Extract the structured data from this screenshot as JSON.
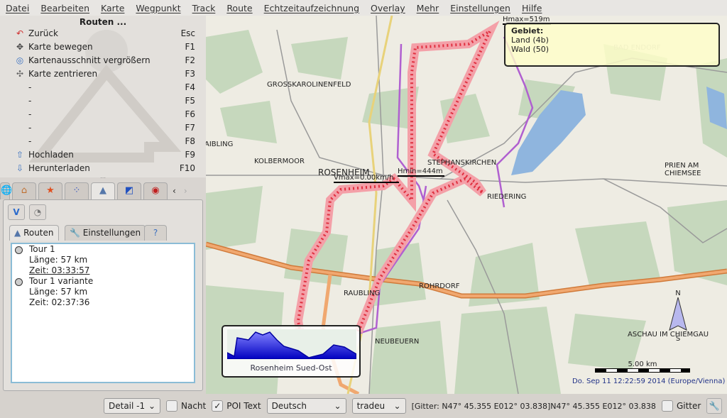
{
  "menu": [
    "Datei",
    "Bearbeiten",
    "Karte",
    "Wegpunkt",
    "Track",
    "Route",
    "Echtzeitaufzeichnung",
    "Overlay",
    "Mehr",
    "Einstellungen",
    "Hilfe"
  ],
  "shortcuts": {
    "title": "Routen ...",
    "items": [
      {
        "icon": "undo-arrow-icon",
        "label": "Zurück",
        "key": "Esc"
      },
      {
        "icon": "move-map-icon",
        "label": "Karte bewegen",
        "key": "F1"
      },
      {
        "icon": "zoom-area-icon",
        "label": "Kartenausschnitt vergrößern",
        "key": "F2"
      },
      {
        "icon": "center-map-icon",
        "label": "Karte zentrieren",
        "key": "F3"
      },
      {
        "icon": "",
        "label": "-",
        "key": "F4"
      },
      {
        "icon": "",
        "label": "-",
        "key": "F5"
      },
      {
        "icon": "",
        "label": "-",
        "key": "F6"
      },
      {
        "icon": "",
        "label": "-",
        "key": "F7"
      },
      {
        "icon": "",
        "label": "-",
        "key": "F8"
      },
      {
        "icon": "upload-arrow-icon",
        "label": "Hochladen",
        "key": "F9"
      },
      {
        "icon": "download-arrow-icon",
        "label": "Herunterladen",
        "key": "F10"
      }
    ]
  },
  "tools_tabs": [
    "globe-icon",
    "home-icon",
    "star-icon",
    "waypoint-icon",
    "route-icon",
    "map-tile-icon",
    "gps-icon"
  ],
  "inner_tabs": {
    "routen": "Routen",
    "einstellungen": "Einstellungen"
  },
  "routes": [
    {
      "name": "Tour 1",
      "length": "Länge: 57 km",
      "time": "Zeit:  03:33:57"
    },
    {
      "name": "Tour 1 variante",
      "length": "Länge: 57 km",
      "time": "Zeit:  02:37:36"
    }
  ],
  "map": {
    "places": [
      "GROSSKAROLINENFELD",
      "KOLBERMOOR",
      "AIBLING",
      "ROSENHEIM",
      "STEPHANSKIRCHEN",
      "PRIEN AM CHIEMSEE",
      "RIEDERING",
      "RAUBLING",
      "ROHRDORF",
      "NEUBEUERN",
      "ASCHAU IM CHIEMGAU",
      "BAD ENDORF"
    ],
    "labels": {
      "hmax": "Hmax=519m",
      "hmin": "Hmin=444m",
      "vmax": "Vmax=0.00km/h"
    },
    "info": {
      "title": "Gebiet:",
      "lines": [
        "Land (4b)",
        "Wald (50)"
      ]
    },
    "profile_title": "Rosenheim Sued-Ost",
    "compass": {
      "n": "N",
      "s": "S"
    },
    "scale": "5.00 km",
    "datetime": "Do. Sep 11 12:22:59 2014 (Europe/Vienna)",
    "colors": {
      "route": "#e03040",
      "route_alt": "#b060d0",
      "highway": "#e8955a"
    }
  },
  "status": {
    "detail": "Detail -1",
    "night": "Nacht",
    "night_checked": false,
    "poi": "POI Text",
    "poi_checked": true,
    "language": "Deutsch",
    "typ": "tradeu",
    "coords": "[Gitter: N47° 45.355 E012° 03.838]N47° 45.355 E012° 03.838",
    "grid": "Gitter",
    "grid_checked": false
  }
}
